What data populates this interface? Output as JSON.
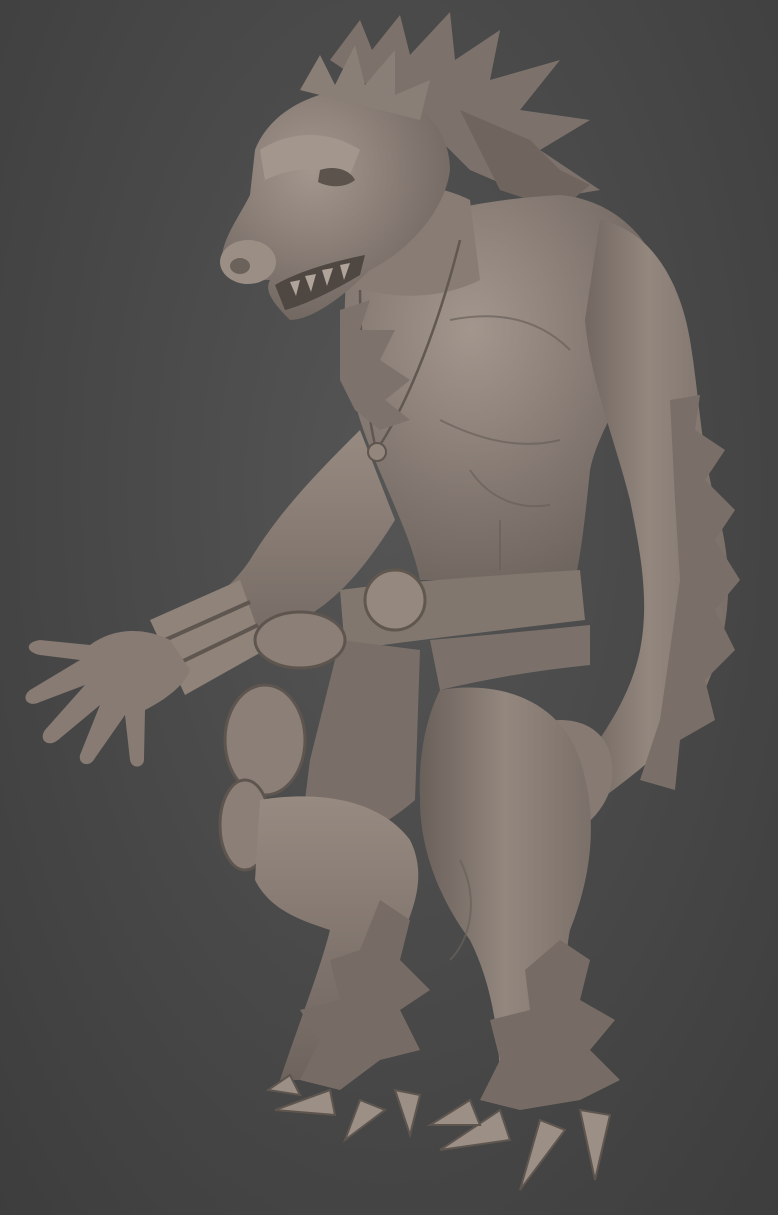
{
  "scene": {
    "background_color": "#474747",
    "model_color": "#8a7e76",
    "model_shadow_color": "#5e554f",
    "model_highlight_color": "#a89c93",
    "subject": "clay-sculpt-werewolf-creature"
  }
}
